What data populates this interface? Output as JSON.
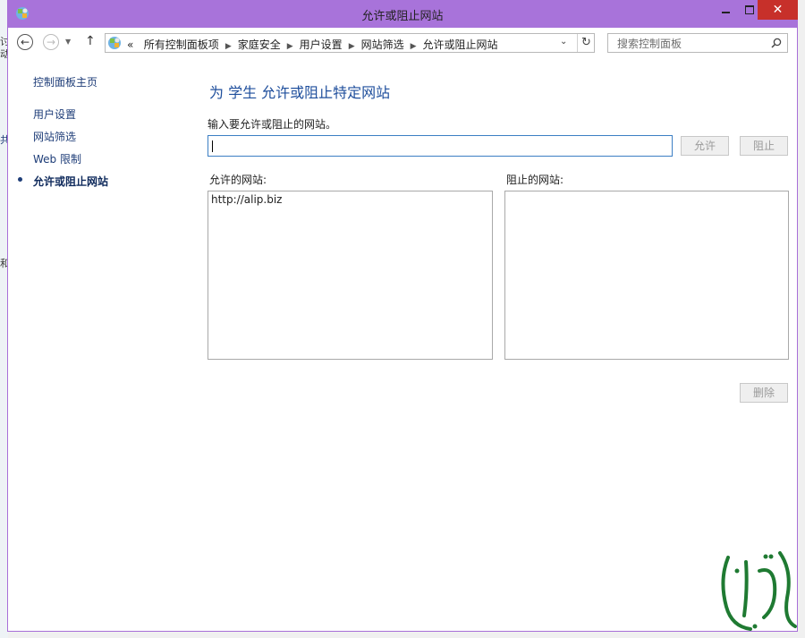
{
  "window": {
    "title": "允许或阻止网站",
    "close_glyph": "✕"
  },
  "desktop_edge": [
    "讨",
    "动",
    "共",
    "和"
  ],
  "navigation": {
    "back_glyph": "←",
    "forward_glyph": "→",
    "up_glyph": "↑",
    "breadcrumb": [
      "«",
      "所有控制面板项",
      "家庭安全",
      "用户设置",
      "网站筛选",
      "允许或阻止网站"
    ],
    "separator": "▶"
  },
  "search": {
    "placeholder": "搜索控制面板"
  },
  "sidebar": {
    "home": "控制面板主页",
    "items": [
      {
        "label": "用户设置"
      },
      {
        "label": "网站筛选"
      },
      {
        "label": "Web 限制"
      },
      {
        "label": "允许或阻止网站"
      }
    ]
  },
  "main": {
    "heading": "为 学生 允许或阻止特定网站",
    "prompt": "输入要允许或阻止的网站。",
    "url_value": "",
    "allow_button": "允许",
    "block_button": "阻止",
    "allowed_label": "允许的网站:",
    "blocked_label": "阻止的网站:",
    "allowed_sites": [
      "http://alip.biz"
    ],
    "blocked_sites": [],
    "delete_button": "删除"
  },
  "colors": {
    "titlebar": "#a873da",
    "close": "#c7302a",
    "link": "#1e3d78",
    "heading": "#1e4e9c",
    "input_focus": "#3c7fc4"
  }
}
